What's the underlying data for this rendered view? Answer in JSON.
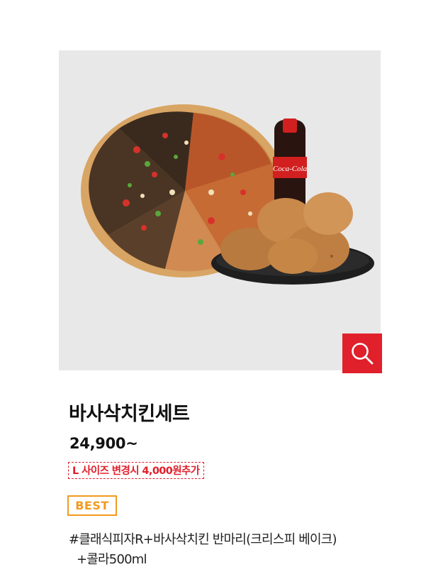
{
  "product": {
    "image_alt": "바사삭치킨세트",
    "name": "바사삭치킨세트",
    "price": "24,900~",
    "size_note": "L 사이즈 변경시 4,000원추가",
    "badge": "BEST",
    "description_line1": "#클래식피자R+바사삭치킨 반마리(크리스피 베이크)",
    "description_line2": "+콜라500ml"
  },
  "icons": {
    "zoom": "magnifier-icon"
  },
  "colors": {
    "accent_red": "#e0202b",
    "badge_orange": "#f39a1f",
    "image_bg": "#e8e8e8"
  }
}
